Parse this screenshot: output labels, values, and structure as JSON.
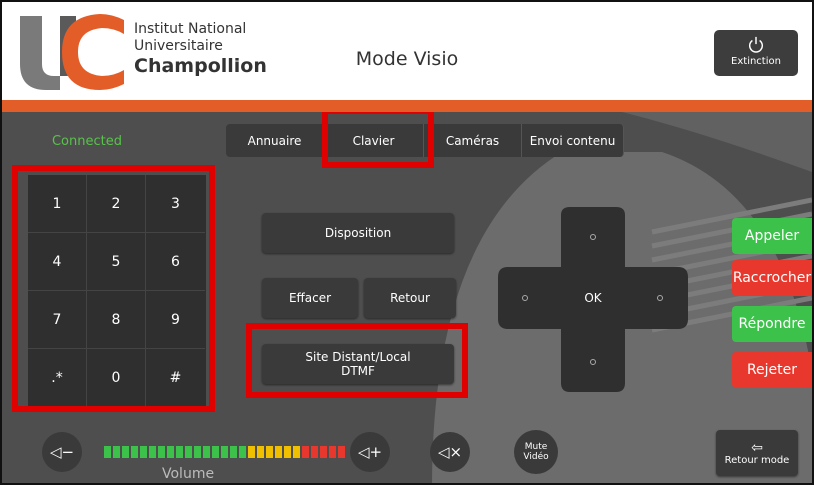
{
  "header": {
    "institution_line1": "Institut National",
    "institution_line2": "Universitaire",
    "institution_line3": "Champollion",
    "mode_title": "Mode Visio",
    "power_label": "Extinction"
  },
  "status": "Connected",
  "tabs": [
    "Annuaire",
    "Clavier",
    "Caméras",
    "Envoi contenu"
  ],
  "keypad": [
    "1",
    "2",
    "3",
    "4",
    "5",
    "6",
    "7",
    "8",
    "9",
    ".*",
    "0",
    "#"
  ],
  "center_buttons": {
    "disposition": "Disposition",
    "effacer": "Effacer",
    "retour": "Retour",
    "site_line1": "Site Distant/Local",
    "site_line2": "DTMF"
  },
  "dpad": {
    "ok": "OK"
  },
  "call_buttons": {
    "appeler": "Appeler",
    "raccrocher": "Raccrocher",
    "repondre": "Répondre",
    "rejeter": "Rejeter"
  },
  "bottom": {
    "volume_label": "Volume",
    "vol_down": "◁−",
    "vol_up": "◁+",
    "mute": "◁×",
    "mute_video_line1": "Mute",
    "mute_video_line2": "Vidéo",
    "retour_mode": "Retour mode"
  },
  "colors": {
    "accent_orange": "#e35d29",
    "green": "#3cc24a",
    "red": "#e8382e",
    "highlight_red": "#e00000"
  }
}
